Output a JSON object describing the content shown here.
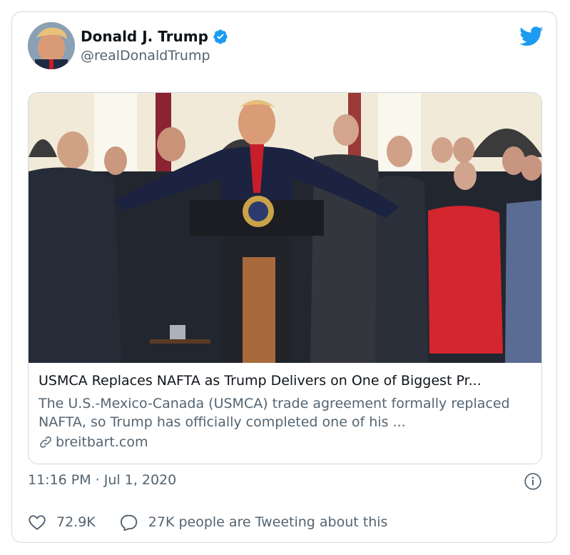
{
  "user": {
    "display_name": "Donald J. Trump",
    "handle": "@realDonaldTrump",
    "verified": true
  },
  "icons": {
    "verified": "verified-badge-icon",
    "brand": "twitter-bird-icon",
    "link": "link-icon",
    "info": "info-icon",
    "like": "heart-icon",
    "reply": "speech-bubble-icon"
  },
  "link_card": {
    "title": "USMCA Replaces NAFTA as Trump Delivers on One of Biggest Pr...",
    "description": "The U.S.-Mexico-Canada (USMCA) trade agreement formally replaced NAFTA, so Trump has officially completed one of his ...",
    "domain": "breitbart.com"
  },
  "meta": {
    "timestamp": "11:16 PM · Jul 1, 2020"
  },
  "actions": {
    "likes": "72.9K",
    "conversation": "27K people are Tweeting about this"
  },
  "colors": {
    "brand_blue": "#1d9bf0",
    "text_primary": "#0f1419",
    "text_secondary": "#536471",
    "border": "#cfd9de"
  }
}
